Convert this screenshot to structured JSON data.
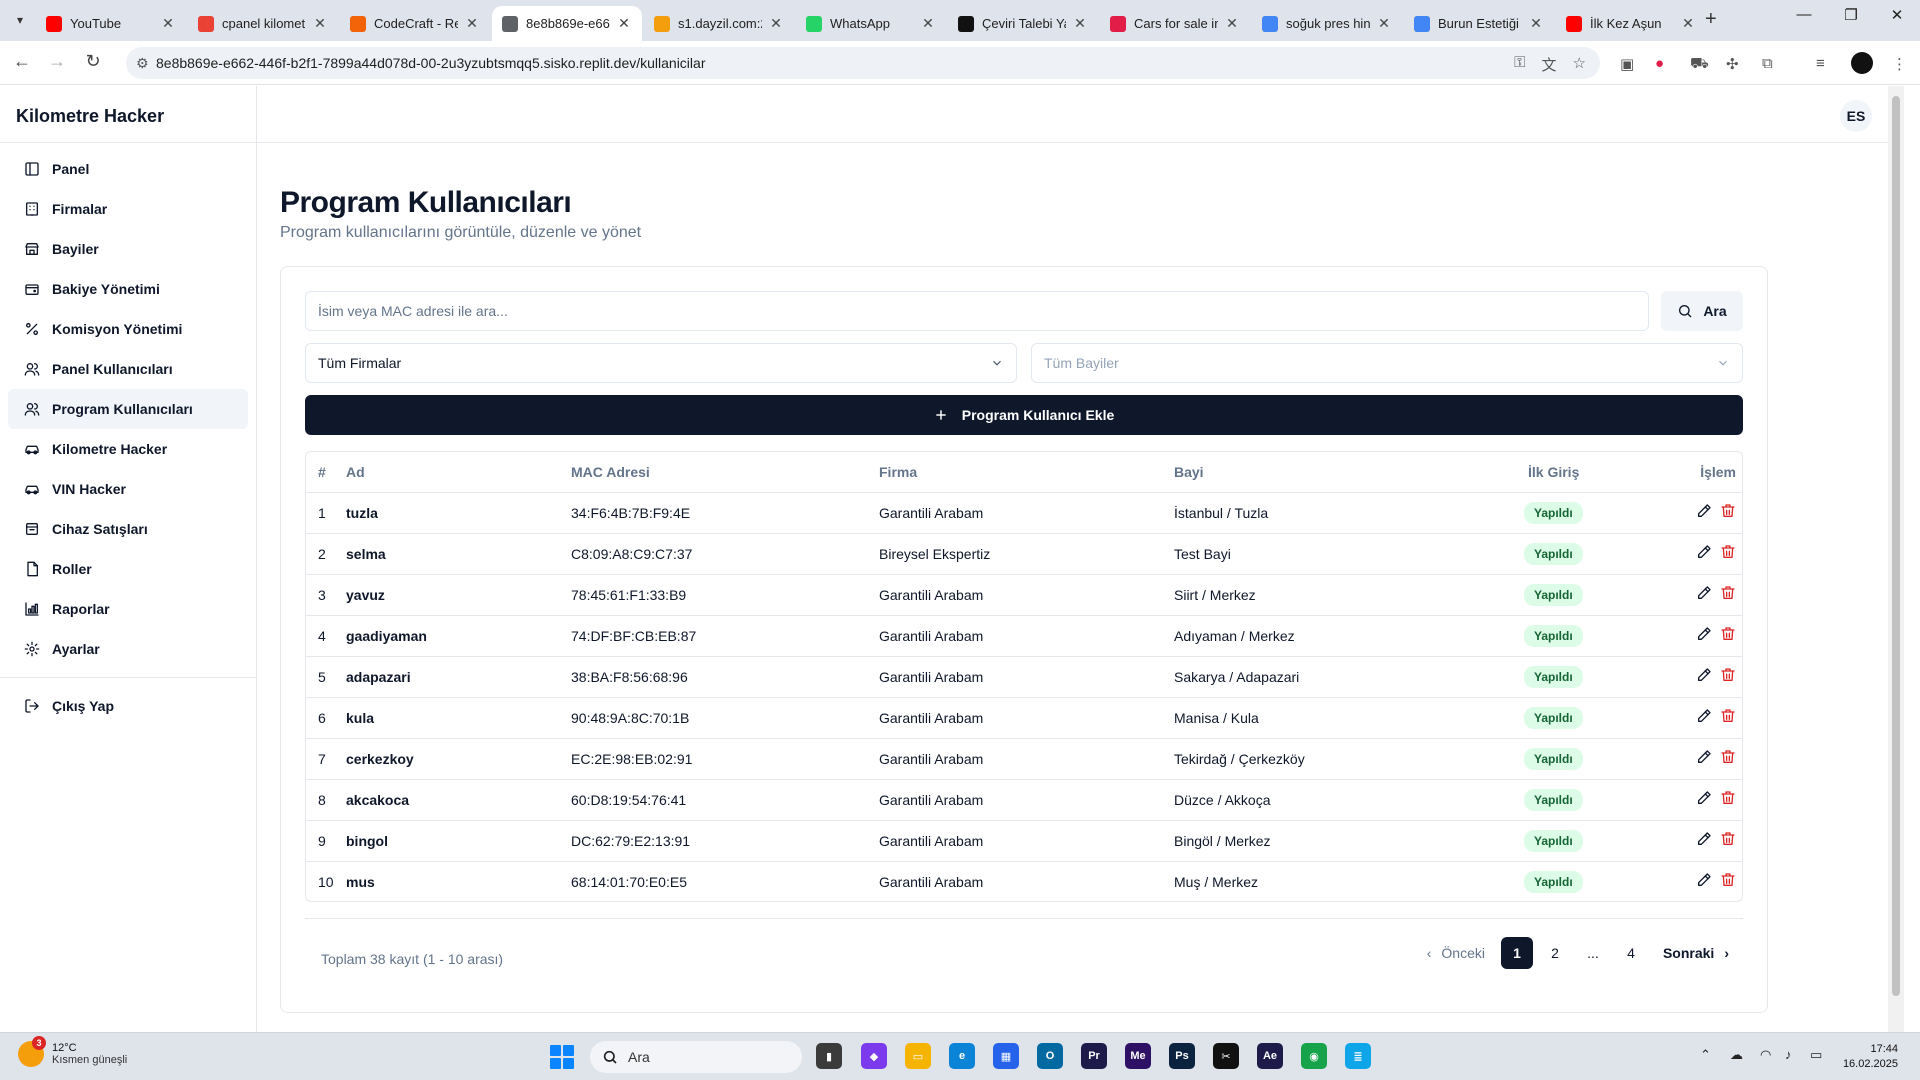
{
  "browser": {
    "tabs": [
      {
        "title": "YouTube",
        "icon": "youtube-icon",
        "color": "#ff0000"
      },
      {
        "title": "cpanel kilomet",
        "icon": "gmail-icon",
        "color": "#ea4335"
      },
      {
        "title": "CodeCraft - Re",
        "icon": "replit-icon",
        "color": "#f26207"
      },
      {
        "title": "8e8b869e-e66",
        "icon": "globe-icon",
        "color": "#5f6368"
      },
      {
        "title": "s1.dayzil.com:2",
        "icon": "chart-icon",
        "color": "#f59e0b"
      },
      {
        "title": "WhatsApp",
        "icon": "whatsapp-icon",
        "color": "#25d366"
      },
      {
        "title": "Çeviri Talebi Ya",
        "icon": "openai-icon",
        "color": "#111111"
      },
      {
        "title": "Cars for sale in",
        "icon": "flame-icon",
        "color": "#e11d48"
      },
      {
        "title": "soğuk pres hin",
        "icon": "google-icon",
        "color": "#4285f4"
      },
      {
        "title": "Burun Estetiği",
        "icon": "google-icon",
        "color": "#4285f4"
      },
      {
        "title": "İlk Kez Aşun",
        "icon": "youtube-icon",
        "color": "#ff0000"
      }
    ],
    "url": "8e8b869e-e662-446f-b2f1-7899a44d078d-00-2u3yzubtsmqq5.sisko.replit.dev/kullanicilar"
  },
  "app": {
    "brand": "Kilometre Hacker",
    "avatar_initials": "ES",
    "nav": [
      {
        "label": "Panel",
        "icon": "layout-icon"
      },
      {
        "label": "Firmalar",
        "icon": "building-icon"
      },
      {
        "label": "Bayiler",
        "icon": "store-icon"
      },
      {
        "label": "Bakiye Yönetimi",
        "icon": "wallet-icon"
      },
      {
        "label": "Komisyon Yönetimi",
        "icon": "percent-icon"
      },
      {
        "label": "Panel Kullanıcıları",
        "icon": "users-icon"
      },
      {
        "label": "Program Kullanıcıları",
        "icon": "users-icon"
      },
      {
        "label": "Kilometre Hacker",
        "icon": "car-icon"
      },
      {
        "label": "VIN Hacker",
        "icon": "car-icon"
      },
      {
        "label": "Cihaz Satışları",
        "icon": "cart-icon"
      },
      {
        "label": "Roller",
        "icon": "file-icon"
      },
      {
        "label": "Raporlar",
        "icon": "chart-icon"
      },
      {
        "label": "Ayarlar",
        "icon": "gear-icon"
      }
    ],
    "logout_label": "Çıkış Yap"
  },
  "page": {
    "title": "Program Kullanıcıları",
    "subtitle": "Program kullanıcılarını görüntüle, düzenle ve yönet",
    "search_placeholder": "İsim veya MAC adresi ile ara...",
    "search_button": "Ara",
    "firma_select": "Tüm Firmalar",
    "bayi_select": "Tüm Bayiler",
    "add_button": "Program Kullanıcı Ekle",
    "columns": [
      "#",
      "Ad",
      "MAC Adresi",
      "Firma",
      "Bayi",
      "İlk Giriş",
      "İşlem"
    ],
    "rows": [
      {
        "idx": "1",
        "ad": "tuzla",
        "mac": "34:F6:4B:7B:F9:4E",
        "firma": "Garantili Arabam",
        "bayi": "İstanbul / Tuzla",
        "giris": "Yapıldı"
      },
      {
        "idx": "2",
        "ad": "selma",
        "mac": "C8:09:A8:C9:C7:37",
        "firma": "Bireysel Ekspertiz",
        "bayi": "Test Bayi",
        "giris": "Yapıldı"
      },
      {
        "idx": "3",
        "ad": "yavuz",
        "mac": "78:45:61:F1:33:B9",
        "firma": "Garantili Arabam",
        "bayi": "Siirt / Merkez",
        "giris": "Yapıldı"
      },
      {
        "idx": "4",
        "ad": "gaadiyaman",
        "mac": "74:DF:BF:CB:EB:87",
        "firma": "Garantili Arabam",
        "bayi": "Adıyaman / Merkez",
        "giris": "Yapıldı"
      },
      {
        "idx": "5",
        "ad": "adapazari",
        "mac": "38:BA:F8:56:68:96",
        "firma": "Garantili Arabam",
        "bayi": "Sakarya / Adapazari",
        "giris": "Yapıldı"
      },
      {
        "idx": "6",
        "ad": "kula",
        "mac": "90:48:9A:8C:70:1B",
        "firma": "Garantili Arabam",
        "bayi": "Manisa / Kula",
        "giris": "Yapıldı"
      },
      {
        "idx": "7",
        "ad": "cerkezkoy",
        "mac": "EC:2E:98:EB:02:91",
        "firma": "Garantili Arabam",
        "bayi": "Tekirdağ / Çerkezköy",
        "giris": "Yapıldı"
      },
      {
        "idx": "8",
        "ad": "akcakoca",
        "mac": "60:D8:19:54:76:41",
        "firma": "Garantili Arabam",
        "bayi": "Düzce / Akkoça",
        "giris": "Yapıldı"
      },
      {
        "idx": "9",
        "ad": "bingol",
        "mac": "DC:62:79:E2:13:91",
        "firma": "Garantili Arabam",
        "bayi": "Bingöl / Merkez",
        "giris": "Yapıldı"
      },
      {
        "idx": "10",
        "ad": "mus",
        "mac": "68:14:01:70:E0:E5",
        "firma": "Garantili Arabam",
        "bayi": "Muş / Merkez",
        "giris": "Yapıldı"
      }
    ],
    "total_text": "Toplam 38 kayıt (1 - 10 arası)",
    "pager": {
      "prev": "Önceki",
      "pages": [
        "1",
        "2",
        "...",
        "4"
      ],
      "next": "Sonraki"
    }
  },
  "taskbar": {
    "weather_temp": "12°C",
    "weather_desc": "Kısmen güneşli",
    "notif_count": "3",
    "search_label": "Ara",
    "time": "17:44",
    "date": "16.02.2025"
  },
  "colors": {
    "primary": "#0f172a",
    "badge_bg": "#dcfce7",
    "badge_fg": "#166534",
    "delete": "#dc2626"
  }
}
